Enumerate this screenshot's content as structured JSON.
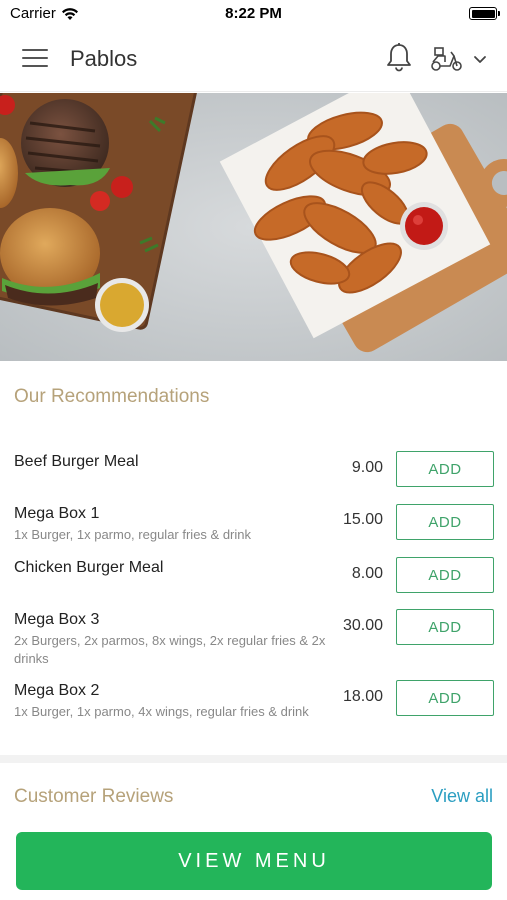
{
  "status_bar": {
    "carrier": "Carrier",
    "time": "8:22 PM"
  },
  "header": {
    "title": "Pablos",
    "icons": [
      "menu-icon",
      "bell-icon",
      "scooter-icon",
      "chevron-down-icon"
    ]
  },
  "hero": {
    "image": "food-banner"
  },
  "recommendations": {
    "title": "Our Recommendations",
    "add_label": "ADD",
    "items": [
      {
        "name": "Beef Burger Meal",
        "description": "",
        "price": "9.00"
      },
      {
        "name": "Mega Box 1",
        "description": "1x Burger, 1x parmo, regular fries & drink",
        "price": "15.00"
      },
      {
        "name": "Chicken Burger Meal",
        "description": "",
        "price": "8.00"
      },
      {
        "name": "Mega Box 3",
        "description": "2x Burgers, 2x parmos, 8x wings, 2x regular fries & 2x drinks",
        "price": "30.00"
      },
      {
        "name": "Mega Box 2",
        "description": "1x Burger, 1x parmo, 4x wings, regular fries & drink",
        "price": "18.00"
      }
    ]
  },
  "reviews": {
    "title": "Customer Reviews",
    "view_all_label": "View all"
  },
  "footer": {
    "view_menu_label": "VIEW MENU"
  },
  "colors": {
    "accent_green": "#23b55a",
    "add_green": "#3fa36a",
    "section_title": "#b6a27a",
    "link_blue": "#2b9ec1"
  }
}
